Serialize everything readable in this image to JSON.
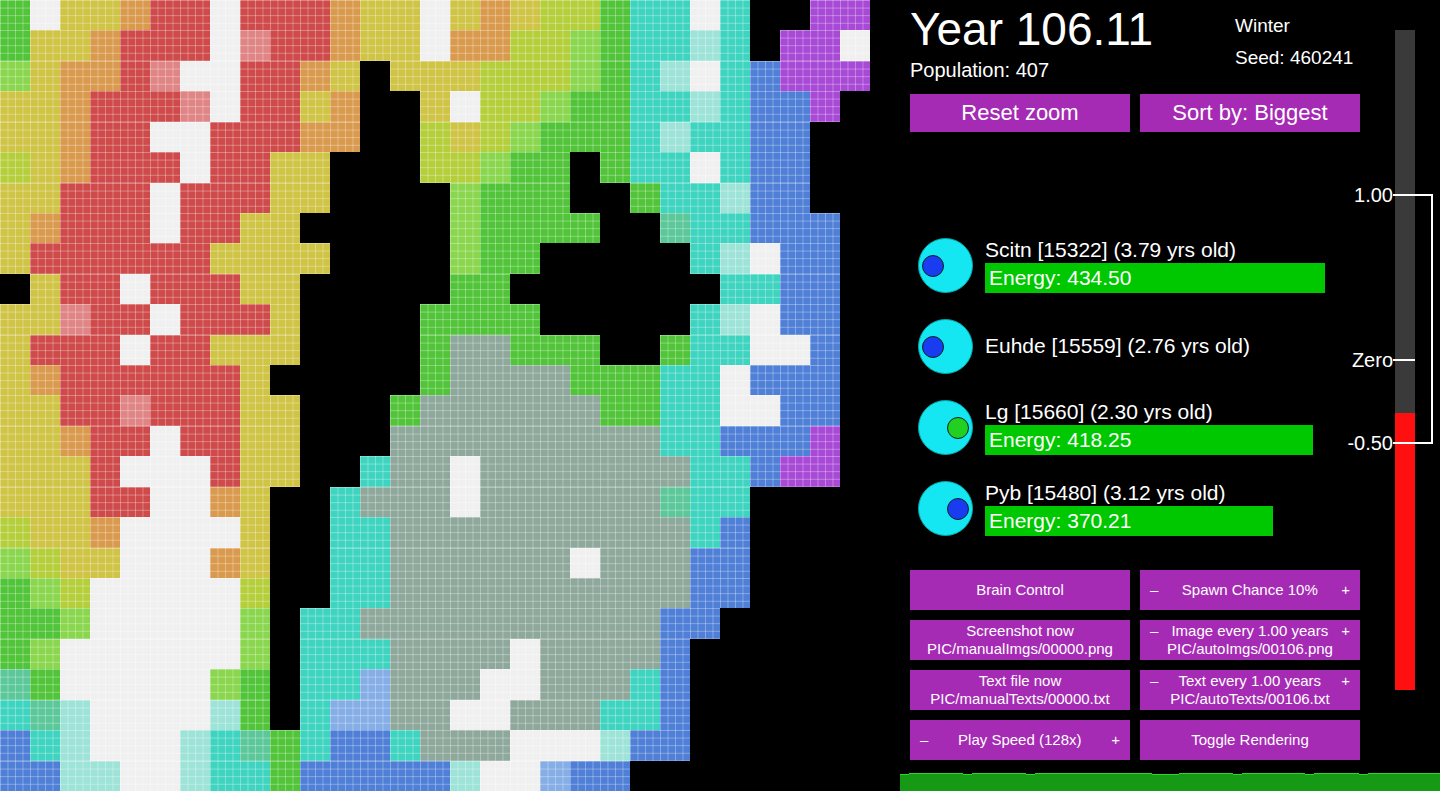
{
  "header": {
    "year": "Year 106.11",
    "population": "Population: 407",
    "season": "Winter",
    "seed": "Seed: 460241"
  },
  "top_buttons": [
    {
      "label": "Reset zoom"
    },
    {
      "label": "Sort by: Biggest"
    }
  ],
  "creatures": [
    {
      "name": "Scitn [15322] (3.79 yrs old)",
      "energy": "Energy: 434.50",
      "level": 0.86,
      "eye_color": "#1a3cf0",
      "facing": "left"
    },
    {
      "name": "Euhde [15559] (2.76 yrs old)",
      "eye_color": "#1a3cf0",
      "facing": "left"
    },
    {
      "name": "Lg [15660] (2.30 yrs old)",
      "energy": "Energy: 418.25",
      "level": 0.83,
      "eye_color": "#22d022",
      "facing": "right"
    },
    {
      "name": "Pyb [15480] (3.12 yrs old)",
      "energy": "Energy: 370.21",
      "level": 0.73,
      "eye_color": "#1a3cf0",
      "facing": "right"
    }
  ],
  "controls": [
    {
      "label": "Brain Control"
    },
    {
      "label": "Spawn Chance 10%",
      "minus": "–",
      "plus": "+"
    },
    {
      "label": "Screenshot now",
      "sub": "PIC/manualImgs/00000.png"
    },
    {
      "label": "Image every 1.00 years",
      "minus": "–",
      "plus": "+",
      "sub": "PIC/autoImgs/00106.png"
    },
    {
      "label": "Text file now",
      "sub": "PIC/manualTexts/00000.txt"
    },
    {
      "label": "Text every 1.00 years",
      "minus": "–",
      "plus": "+",
      "sub": "PIC/autoTexts/00106.txt"
    },
    {
      "label": "Play Speed (128x)",
      "minus": "–",
      "plus": "+"
    },
    {
      "label": "Toggle Rendering"
    }
  ],
  "brain_scale": {
    "min": -2,
    "max": 2,
    "level": 0.42,
    "ticks": [
      {
        "label": "1.00",
        "value": 1
      },
      {
        "label": "Zero",
        "value": 0
      },
      {
        "label": "-0.50",
        "value": -0.5
      }
    ],
    "bracket": {
      "from": 1,
      "to": -0.5
    }
  },
  "population_graph": {
    "values": [
      395,
      402,
      398,
      405,
      410,
      407,
      400,
      396,
      399,
      404,
      408,
      412,
      409,
      403,
      397,
      401,
      406,
      411,
      414,
      410,
      405,
      400,
      398,
      402,
      407,
      409,
      404,
      399,
      395,
      393,
      397,
      403,
      408,
      410,
      406,
      401,
      398,
      396,
      400,
      405,
      409,
      411,
      407,
      402,
      399,
      397,
      401,
      404,
      406,
      403,
      399,
      396,
      398,
      402,
      405,
      403,
      400,
      404,
      407,
      407
    ]
  },
  "map": {
    "palette": {
      "k": {
        "color": "#000000",
        "kind": "water"
      },
      "G": {
        "color": "#52c43a",
        "kind": "land"
      },
      "g": {
        "color": "#8ad64e",
        "kind": "land"
      },
      "L": {
        "color": "#b5cf3c",
        "kind": "land"
      },
      "Y": {
        "color": "#cfc446",
        "kind": "land"
      },
      "O": {
        "color": "#d99a4e",
        "kind": "land"
      },
      "R": {
        "color": "#cf4a4a",
        "kind": "land"
      },
      "r": {
        "color": "#e08585",
        "kind": "land"
      },
      "W": {
        "color": "#f0f0f0",
        "kind": "land"
      },
      "C": {
        "color": "#3fd4c0",
        "kind": "land"
      },
      "c": {
        "color": "#9ee3d8",
        "kind": "land"
      },
      "B": {
        "color": "#4f7fd6",
        "kind": "land"
      },
      "b": {
        "color": "#86aee6",
        "kind": "land"
      },
      "P": {
        "color": "#a84ad6",
        "kind": "land"
      },
      "S": {
        "color": "#8fa89c",
        "kind": "land"
      },
      "T": {
        "color": "#5cc89a",
        "kind": "land"
      }
    },
    "rows": [
      "GWYYORRWRRROYYWYOYLLGCCWCkkPPk",
      "GYYORRRWrRROYYWOOLLgGCCcCkPPWk",
      "gYOORrWWRROYkYYYLLLgGCcWCBPPPk",
      "YYORRRrWRRYOkkYWLLgGGCCcCBBPkk",
      "YYORRWWRRROOkkLYLgGGGCcCCBBkkk",
      "LYORRRWRRYYkkkLLgGGkGCCWCBBkkk",
      "YYRRRWRRRYYkkkkgGGGkkGCCcBBkkk",
      "YORRRWRRYYkkkkkgGGGGkkTCCBBBkk",
      "YRRRRRRYYYYkkkkgGGkkkkkCcWBBkk",
      "kYRRWRRRYYkkkkkGGkkkkkkkCCBBkk",
      "YYrRRWRRRYkkkkGGGGkkkkkCcWBBkk",
      "YRRRWRRYYYkkkkGSSGGGkkGCCWWBkk",
      "YORRRRRRYkkkkkGSSSSGGGCCWBBBkk",
      "YYRRrRRRYYkkkGSSSSSSGGCCWWBBkk",
      "YYORRWRRYYkkkSSSSSSSSSCCBBBPkk",
      "YYYRWWWRYYkkCSSWSSSSSSSCCBPPkk",
      "YYYRRWWOYkkCSSSWSSSSSSTCCkkkkk",
      "LYYOWWWWYkkCCSSSSSSSSSSCBkkkkk",
      "gLYYWWWOYkkCCSSSSSSWSSSBBkkkkk",
      "GgLWWWWWLkkCCSSSSSSSSSSBBkkkkk",
      "GGgWWWWWgkCCSSSSSSSSSSBBkkkkkk",
      "GgWWWWWWgkCCCSSSSWSSSSBkkkkkkk",
      "TGWWWWWgGkCCbSSSWWSSSCBkkkkkkk",
      "CTcWWWWcGkCbbSSWWSSSCCBkkkkkkk",
      "BCcWWWcCTGCBBCSSSWWWcBBkkkkkkk",
      "BBccWWcCCGBBBBBcWWbBBkkkkkkkkk"
    ]
  }
}
